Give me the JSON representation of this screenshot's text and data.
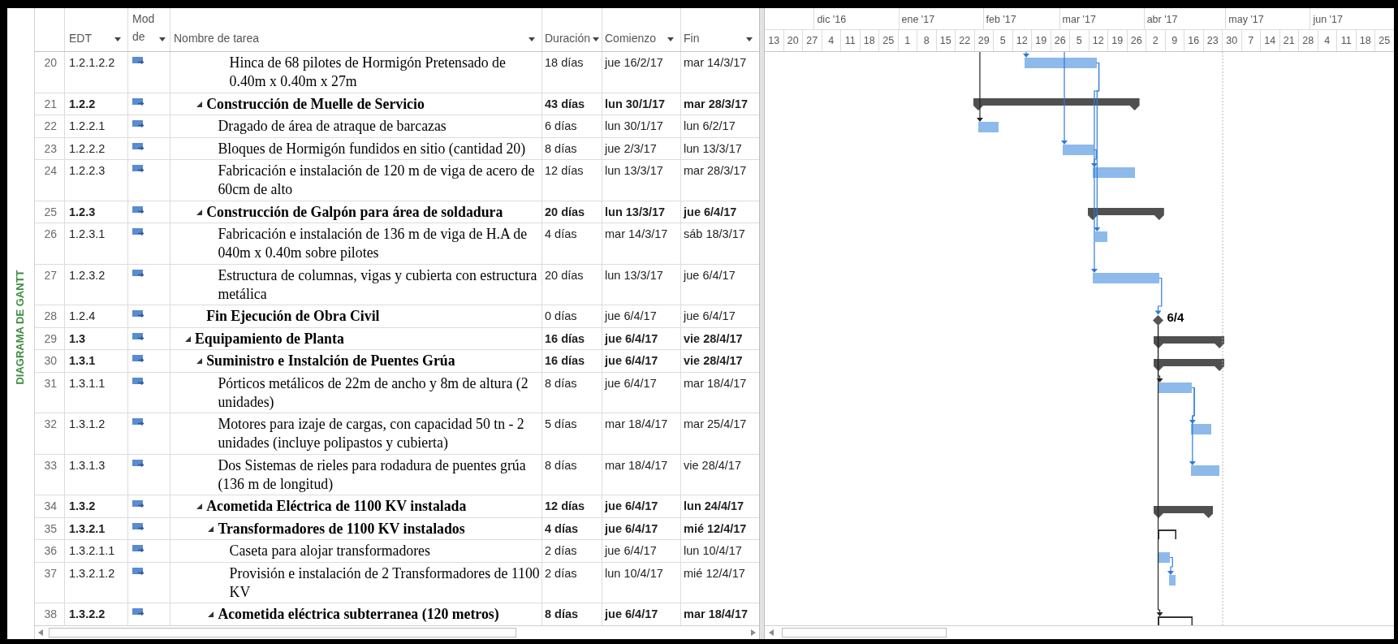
{
  "view_label": "DIAGRAMA DE GANTT",
  "columns": [
    {
      "label": "EDT"
    },
    {
      "label": "Mod de"
    },
    {
      "label": "Nombre de tarea"
    },
    {
      "label": "Duración"
    },
    {
      "label": "Comienzo"
    },
    {
      "label": "Fin"
    }
  ],
  "timeline": {
    "months": [
      "dic '16",
      "ene '17",
      "feb '17",
      "mar '17",
      "abr '17",
      "may '17",
      "jun '17"
    ],
    "weeks": [
      "13",
      "20",
      "27",
      "4",
      "11",
      "18",
      "25",
      "1",
      "8",
      "15",
      "22",
      "29",
      "5",
      "12",
      "19",
      "26",
      "5",
      "12",
      "19",
      "26",
      "2",
      "9",
      "16",
      "23",
      "30",
      "7",
      "14",
      "21",
      "28",
      "4",
      "11",
      "18",
      "25"
    ]
  },
  "rows": [
    {
      "row": "20",
      "wbs": "1.2.1.2.2",
      "name": "Hinca de 68 pilotes de Hormigón Pretensado de 0.40m x 0.40m x 27m",
      "duration": "18 días",
      "start": "jue 16/2/17",
      "finish": "mar 14/3/17",
      "kind": "task"
    },
    {
      "row": "21",
      "wbs": "1.2.2",
      "name": "Construcción de Muelle de Servicio",
      "duration": "43 días",
      "start": "lun 30/1/17",
      "finish": "mar 28/3/17",
      "kind": "summary",
      "expanded": true,
      "children": [
        {
          "row": "22",
          "wbs": "1.2.2.1",
          "name": "Dragado de área de atraque de barcazas",
          "duration": "6 días",
          "start": "lun 30/1/17",
          "finish": "lun 6/2/17",
          "kind": "task"
        },
        {
          "row": "23",
          "wbs": "1.2.2.2",
          "name": "Bloques de Hormigón fundidos en sitio (cantidad 20)",
          "duration": "8 días",
          "start": "jue 2/3/17",
          "finish": "lun 13/3/17",
          "kind": "task"
        },
        {
          "row": "24",
          "wbs": "1.2.2.3",
          "name": "Fabricación e instalación de 120 m de viga de acero de 60cm de alto",
          "duration": "12 días",
          "start": "lun 13/3/17",
          "finish": "mar 28/3/17",
          "kind": "task"
        }
      ]
    },
    {
      "row": "25",
      "wbs": "1.2.3",
      "name": "Construcción de Galpón para área de soldadura",
      "duration": "20 días",
      "start": "lun 13/3/17",
      "finish": "jue 6/4/17",
      "kind": "summary",
      "expanded": true,
      "children": [
        {
          "row": "26",
          "wbs": "1.2.3.1",
          "name": "Fabricación e instalación de 136 m de viga de H.A de 040m x 0.40m sobre pilotes",
          "duration": "4 días",
          "start": "mar 14/3/17",
          "finish": "sáb 18/3/17",
          "kind": "task"
        },
        {
          "row": "27",
          "wbs": "1.2.3.2",
          "name": "Estructura de columnas, vigas y cubierta con estructura metálica",
          "duration": "20 días",
          "start": "lun 13/3/17",
          "finish": "jue 6/4/17",
          "kind": "task"
        }
      ]
    },
    {
      "row": "28",
      "wbs": "1.2.4",
      "name": "Fin Ejecución de Obra Civil",
      "duration": "0 días",
      "start": "jue 6/4/17",
      "finish": "jue 6/4/17",
      "kind": "milestone",
      "milestone_label": "6/4"
    },
    {
      "row": "29",
      "wbs": "1.3",
      "name": "Equipamiento de Planta",
      "duration": "16 días",
      "start": "jue 6/4/17",
      "finish": "vie 28/4/17",
      "kind": "summary",
      "expanded": true,
      "children": [
        {
          "row": "30",
          "wbs": "1.3.1",
          "name": "Suministro e Instalción de Puentes Grúa",
          "duration": "16 días",
          "start": "jue 6/4/17",
          "finish": "vie 28/4/17",
          "kind": "summary",
          "expanded": true,
          "children": [
            {
              "row": "31",
              "wbs": "1.3.1.1",
              "name": "Pórticos metálicos de 22m de ancho y 8m de altura (2 unidades)",
              "duration": "8 días",
              "start": "jue 6/4/17",
              "finish": "mar 18/4/17",
              "kind": "task"
            },
            {
              "row": "32",
              "wbs": "1.3.1.2",
              "name": "Motores para izaje de cargas, con capacidad 50 tn - 2 unidades (incluye polipastos y cubierta)",
              "duration": "5 días",
              "start": "mar 18/4/17",
              "finish": "mar 25/4/17",
              "kind": "task"
            },
            {
              "row": "33",
              "wbs": "1.3.1.3",
              "name": "Dos Sistemas de rieles para rodadura de puentes grúa (136 m de longitud)",
              "duration": "8 días",
              "start": "mar 18/4/17",
              "finish": "vie 28/4/17",
              "kind": "task"
            }
          ]
        },
        {
          "row": "34",
          "wbs": "1.3.2",
          "name": "Acometida Eléctrica de 1100 KV instalada",
          "duration": "12 días",
          "start": "jue 6/4/17",
          "finish": "lun 24/4/17",
          "kind": "summary",
          "expanded": true,
          "children": [
            {
              "row": "35",
              "wbs": "1.3.2.1",
              "name": "Transformadores de 1100 KV instalados",
              "duration": "4 días",
              "start": "jue 6/4/17",
              "finish": "mié 12/4/17",
              "kind": "manual-summary",
              "expanded": true,
              "children": [
                {
                  "row": "36",
                  "wbs": "1.3.2.1.1",
                  "name": "Caseta para alojar transformadores",
                  "duration": "2 días",
                  "start": "jue 6/4/17",
                  "finish": "lun 10/4/17",
                  "kind": "task"
                },
                {
                  "row": "37",
                  "wbs": "1.3.2.1.2",
                  "name": "Provisión e instalación de 2 Transformadores de 1100 KV",
                  "duration": "2 días",
                  "start": "lun 10/4/17",
                  "finish": "mié 12/4/17",
                  "kind": "task"
                }
              ]
            },
            {
              "row": "38",
              "wbs": "1.3.2.2",
              "name": "Acometida eléctrica subterranea (120 metros)",
              "duration": "8 días",
              "start": "jue 6/4/17",
              "finish": "mar 18/4/17",
              "kind": "manual-summary",
              "expanded": true
            }
          ]
        }
      ]
    }
  ]
}
